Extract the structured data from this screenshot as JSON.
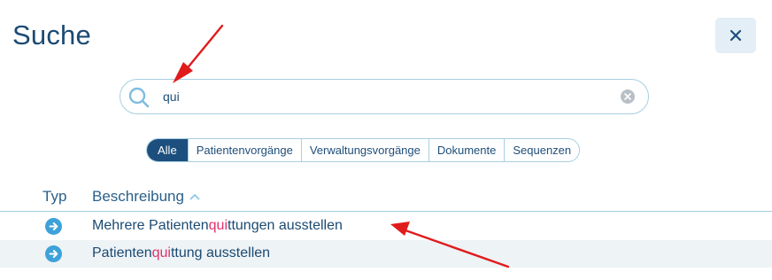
{
  "header": {
    "title": "Suche",
    "close_icon": "close-icon"
  },
  "search": {
    "value": "qui",
    "icon": "search-icon",
    "clear_icon": "clear-icon"
  },
  "filters": [
    {
      "label": "Alle",
      "active": true
    },
    {
      "label": "Patientenvorgänge",
      "active": false
    },
    {
      "label": "Verwaltungsvorgänge",
      "active": false
    },
    {
      "label": "Dokumente",
      "active": false
    },
    {
      "label": "Sequenzen",
      "active": false
    }
  ],
  "table": {
    "columns": {
      "typ": "Typ",
      "beschreibung": "Beschreibung"
    },
    "sort_icon": "chevron-up-icon",
    "rows": [
      {
        "before": "Mehrere Patienten",
        "match": "qui",
        "after": "ttungen ausstellen",
        "icon": "arrow-right-circle-icon"
      },
      {
        "before": "Patienten",
        "match": "qui",
        "after": "ttung ausstellen",
        "icon": "arrow-right-circle-icon"
      }
    ]
  },
  "colors": {
    "accent": "#1c4f7d",
    "highlight": "#e0306c",
    "annotation": "#e01b1b",
    "border": "#a7cfe3"
  }
}
